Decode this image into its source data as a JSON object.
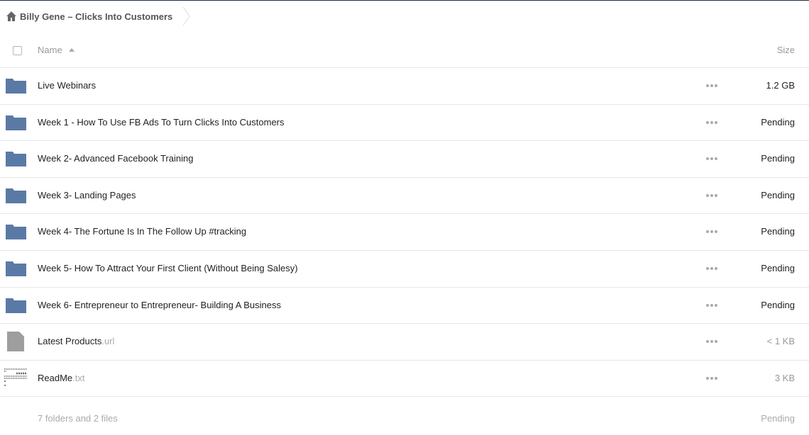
{
  "breadcrumb": {
    "home_icon": "home-icon",
    "current": "Billy Gene – Clicks Into Customers"
  },
  "header": {
    "name_label": "Name",
    "size_label": "Size",
    "sort": "ascending"
  },
  "colors": {
    "folder": "#5a7aa5",
    "file": "#9e9e9e",
    "muted_text": "#aaaaaa",
    "separator": "#e6e6e6"
  },
  "files": [
    {
      "type": "folder",
      "icon": "folder-icon",
      "name": "Live Webinars",
      "ext": "",
      "size": "1.2 GB"
    },
    {
      "type": "folder",
      "icon": "folder-icon",
      "name": "Week 1 - How To Use FB Ads To Turn Clicks Into Customers",
      "ext": "",
      "size": "Pending"
    },
    {
      "type": "folder",
      "icon": "folder-icon",
      "name": "Week 2- Advanced Facebook Training",
      "ext": "",
      "size": "Pending"
    },
    {
      "type": "folder",
      "icon": "folder-icon",
      "name": "Week 3- Landing Pages",
      "ext": "",
      "size": "Pending"
    },
    {
      "type": "folder",
      "icon": "folder-icon",
      "name": "Week 4- The Fortune Is In The Follow Up #tracking",
      "ext": "",
      "size": "Pending"
    },
    {
      "type": "folder",
      "icon": "folder-icon",
      "name": "Week 5- How To Attract Your First Client (Without Being Salesy)",
      "ext": "",
      "size": "Pending"
    },
    {
      "type": "folder",
      "icon": "folder-icon",
      "name": "Week 6- Entrepreneur to Entrepreneur- Building A Business",
      "ext": "",
      "size": "Pending"
    },
    {
      "type": "file",
      "icon": "file-icon",
      "name": "Latest Products",
      "ext": ".url",
      "size": "< 1 KB"
    },
    {
      "type": "text",
      "icon": "text-file-thumbnail",
      "name": "ReadMe",
      "ext": ".txt",
      "size": "3 KB"
    }
  ],
  "summary": {
    "text": "7 folders and 2 files",
    "size": "Pending"
  }
}
